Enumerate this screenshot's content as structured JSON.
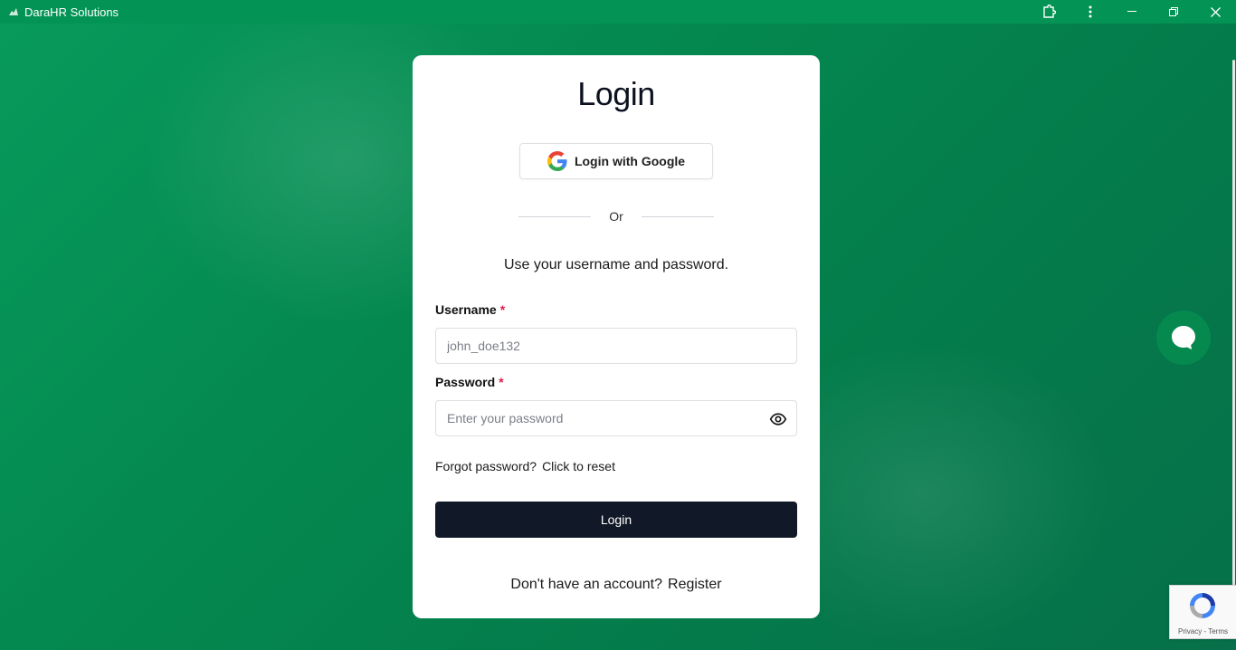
{
  "window": {
    "title": "DaraHR Solutions"
  },
  "login": {
    "title": "Login",
    "google_button": "Login with Google",
    "divider_text": "Or",
    "subtitle": "Use your username and password.",
    "username": {
      "label": "Username",
      "required_mark": "*",
      "placeholder": "john_doe132"
    },
    "password": {
      "label": "Password",
      "required_mark": "*",
      "placeholder": "Enter your password"
    },
    "forgot_text": "Forgot password?",
    "reset_link": "Click to reset",
    "login_button": "Login",
    "register_text": "Don't have an account?",
    "register_link": "Register"
  },
  "recaptcha": {
    "links": "Privacy - Terms"
  },
  "colors": {
    "background": "#05834f",
    "titlebar": "#039455",
    "primary_button": "#111827",
    "required": "#e11d48",
    "chat": "#06894f"
  }
}
